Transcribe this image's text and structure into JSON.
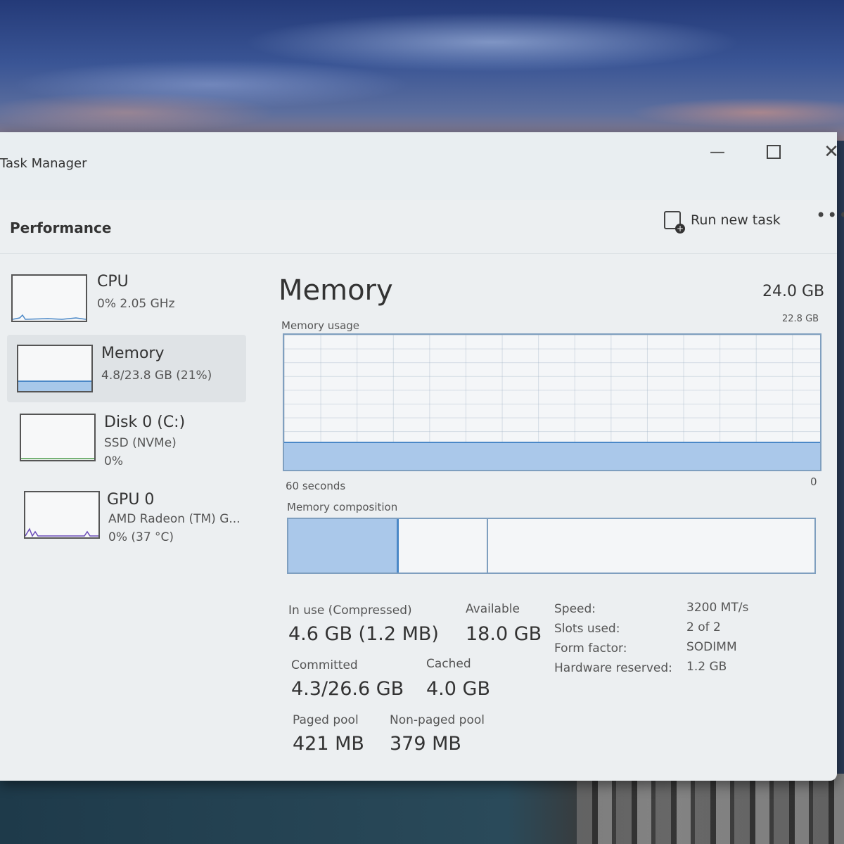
{
  "window": {
    "title": "Task Manager"
  },
  "header": {
    "page_title": "Performance",
    "run_new_task": "Run new task"
  },
  "sidebar": {
    "items": [
      {
        "name": "CPU",
        "line1": "0% 2.05 GHz"
      },
      {
        "name": "Memory",
        "line1": "4.8/23.8 GB (21%)",
        "usage_fraction": 0.21
      },
      {
        "name": "Disk 0 (C:)",
        "line1": "SSD (NVMe)",
        "line2": "0%"
      },
      {
        "name": "GPU 0",
        "line1": "AMD Radeon (TM) G...",
        "line2": "0% (37 °C)"
      }
    ]
  },
  "detail": {
    "title": "Memory",
    "total": "24.0 GB",
    "usage_label": "Memory usage",
    "usage_max": "22.8 GB",
    "axis_left": "60 seconds",
    "axis_right": "0",
    "usage_fraction": 0.2,
    "composition_label": "Memory composition",
    "composition": {
      "in_use_fraction": 0.21,
      "modified_fraction": 0.17
    }
  },
  "stats": {
    "in_use_label": "In use (Compressed)",
    "in_use_value": "4.6 GB (1.2 MB)",
    "available_label": "Available",
    "available_value": "18.0 GB",
    "committed_label": "Committed",
    "committed_value": "4.3/26.6 GB",
    "cached_label": "Cached",
    "cached_value": "4.0 GB",
    "paged_label": "Paged pool",
    "paged_value": "421 MB",
    "nonpaged_label": "Non-paged pool",
    "nonpaged_value": "379 MB"
  },
  "properties": [
    {
      "key": "Speed:",
      "value": "3200 MT/s"
    },
    {
      "key": "Slots used:",
      "value": "2 of 2"
    },
    {
      "key": "Form factor:",
      "value": "SODIMM"
    },
    {
      "key": "Hardware reserved:",
      "value": "1.2 GB"
    }
  ],
  "colors": {
    "accent_fill": "#aac8ea",
    "accent_line": "#4b88c7"
  }
}
